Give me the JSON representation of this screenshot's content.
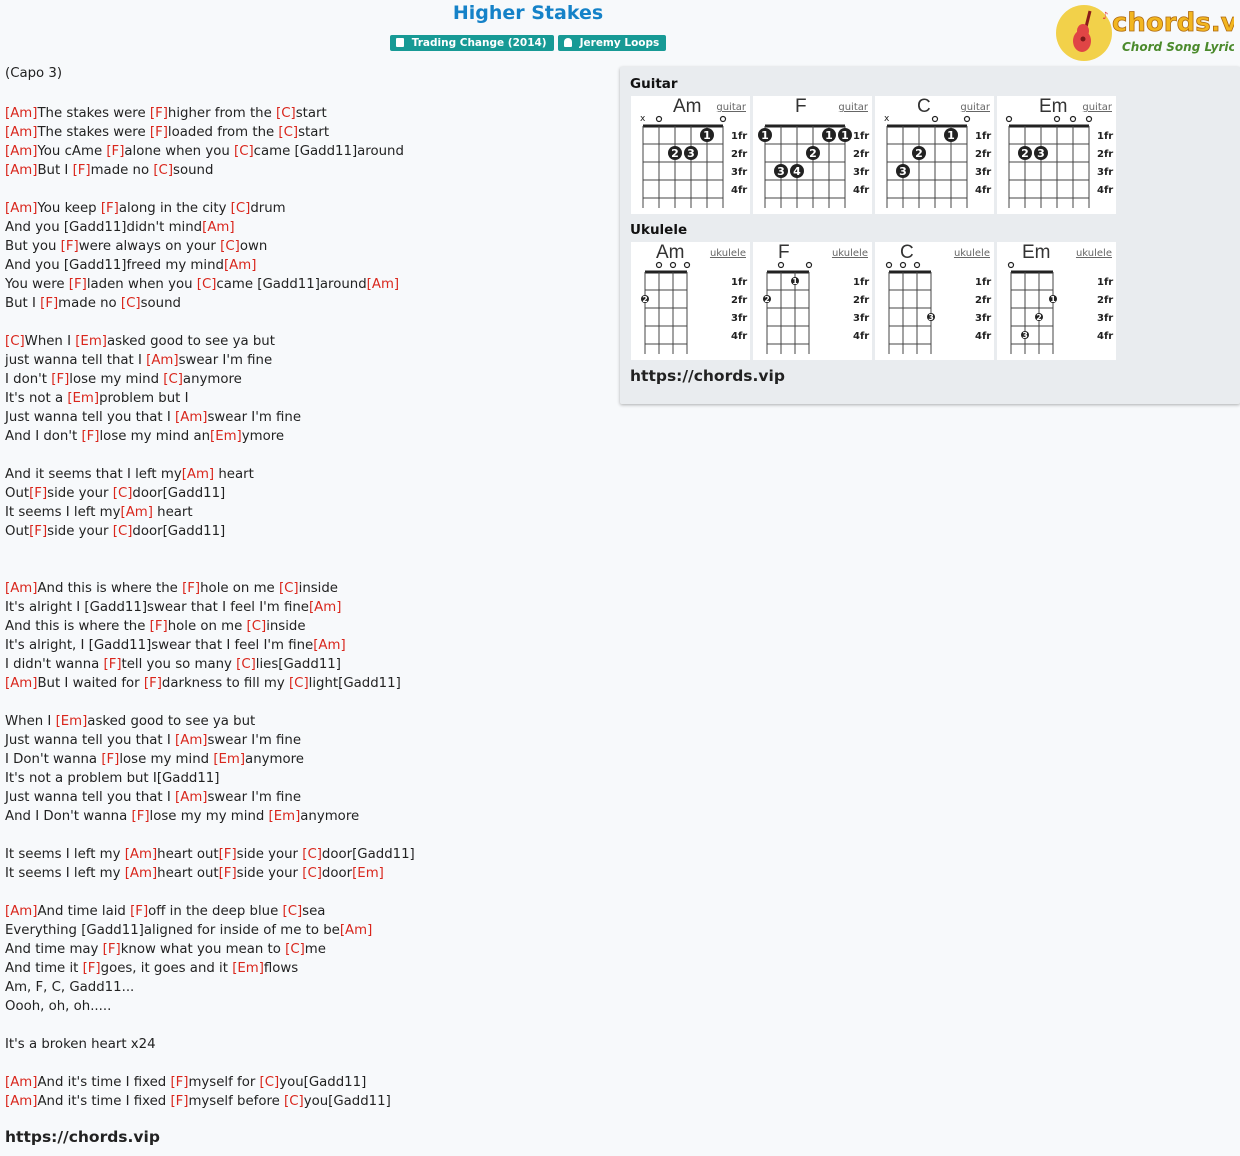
{
  "song": {
    "title": "Higher Stakes",
    "album_badge": "Trading Change (2014)",
    "artist_badge": "Jeremy Loops",
    "capo": "(Capo 3)"
  },
  "logo": {
    "brand": "chords.vip",
    "tagline": "Chord Song Lyric"
  },
  "lyrics": [
    "[Am]The stakes were [F]higher from the [C]start",
    "[Am]The stakes were [F]loaded from the [C]start",
    "[Am]You cAme [F]alone when you [C]came [Gadd11]around",
    "[Am]But I [F]made no [C]sound",
    "",
    "[Am]You keep [F]along in the city [C]drum",
    "And you [Gadd11]didn't mind[Am]",
    "But you [F]were always on your [C]own",
    "And you [Gadd11]freed my mind[Am]",
    "You were [F]laden when you [C]came [Gadd11]around[Am]",
    "But I [F]made no [C]sound",
    "",
    "[C]When I [Em]asked good to see ya but",
    "just wanna tell that I [Am]swear I'm fine",
    "I don't [F]lose my mind [C]anymore",
    "It's not a [Em]problem but I",
    "Just wanna tell you that I [Am]swear I'm fine",
    "And I don't [F]lose my mind an[Em]ymore",
    "",
    "And it seems that I left my[Am] heart",
    "Out[F]side your [C]door[Gadd11]",
    "It seems I left my[Am] heart",
    "Out[F]side your [C]door[Gadd11]",
    "",
    "",
    "[Am]And this is where the [F]hole on me [C]inside",
    "It's alright I [Gadd11]swear that I feel I'm fine[Am]",
    "And this is where the [F]hole on me [C]inside",
    "It's alright, I [Gadd11]swear that I feel I'm fine[Am]",
    "I didn't wanna [F]tell you so many [C]lies[Gadd11]",
    "[Am]But I waited for [F]darkness to fill my [C]light[Gadd11]",
    "",
    "When I [Em]asked good to see ya but",
    "Just wanna tell you that I [Am]swear I'm fine",
    "I Don't wanna [F]lose my mind [Em]anymore",
    "It's not a problem but I[Gadd11]",
    "Just wanna tell you that I [Am]swear I'm fine",
    "And I Don't wanna [F]lose my my mind [Em]anymore",
    "",
    "It seems I left my [Am]heart out[F]side your [C]door[Gadd11]",
    "It seems I left my [Am]heart out[F]side your [C]door[Em]",
    "",
    "[Am]And time laid [F]off in the deep blue [C]sea",
    "Everything [Gadd11]aligned for inside of me to be[Am]",
    "And time may [F]know what you mean to [C]me",
    "And time it [F]goes, it goes and it [Em]flows",
    "Am, F, C, Gadd11...",
    "Oooh, oh, oh.....",
    "",
    "It's a broken heart x24",
    "",
    "[Am]And it's time I fixed [F]myself for [C]you[Gadd11]",
    "[Am]And it's time I fixed [F]myself before [C]you[Gadd11]"
  ],
  "chord_panel": {
    "guitar_heading": "Guitar",
    "ukulele_heading": "Ukulele",
    "link": "https://chords.vip",
    "fret_labels": [
      "1fr",
      "2fr",
      "3fr",
      "4fr"
    ],
    "guitar": [
      {
        "name": "Am",
        "type": "guitar",
        "strings": [
          "x",
          0,
          2,
          2,
          1,
          0
        ],
        "fingers": [
          "",
          0,
          2,
          3,
          1,
          0
        ]
      },
      {
        "name": "F",
        "type": "guitar",
        "strings": [
          1,
          3,
          3,
          2,
          1,
          1
        ],
        "fingers": [
          1,
          3,
          4,
          2,
          1,
          1
        ]
      },
      {
        "name": "C",
        "type": "guitar",
        "strings": [
          "x",
          3,
          2,
          0,
          1,
          0
        ],
        "fingers": [
          "",
          3,
          2,
          0,
          1,
          0
        ]
      },
      {
        "name": "Em",
        "type": "guitar",
        "strings": [
          0,
          2,
          2,
          0,
          0,
          0
        ],
        "fingers": [
          0,
          2,
          3,
          0,
          0,
          0
        ]
      }
    ],
    "ukulele": [
      {
        "name": "Am",
        "type": "ukulele",
        "strings": [
          2,
          0,
          0,
          0
        ],
        "fingers": [
          2,
          0,
          0,
          0
        ]
      },
      {
        "name": "F",
        "type": "ukulele",
        "strings": [
          2,
          0,
          1,
          0
        ],
        "fingers": [
          2,
          0,
          1,
          0
        ]
      },
      {
        "name": "C",
        "type": "ukulele",
        "strings": [
          0,
          0,
          0,
          3
        ],
        "fingers": [
          0,
          0,
          0,
          3
        ]
      },
      {
        "name": "Em",
        "type": "ukulele",
        "strings": [
          0,
          4,
          3,
          2
        ],
        "fingers": [
          0,
          3,
          2,
          1
        ]
      }
    ]
  },
  "footer_link": "https://chords.vip",
  "colors": {
    "title": "#1582c8",
    "chord": "#d9261c",
    "badge": "#179a95"
  }
}
